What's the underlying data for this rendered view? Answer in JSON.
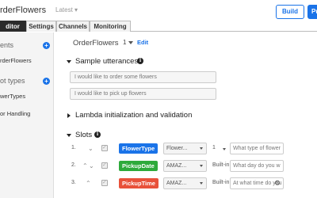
{
  "header": {
    "bot_name": "rderFlowers",
    "version": "Latest ▾",
    "build_label": "Build",
    "publish_label": "Pu"
  },
  "tabs": [
    {
      "label": "ditor",
      "active": true
    },
    {
      "label": "Settings",
      "active": false
    },
    {
      "label": "Channels",
      "active": false
    },
    {
      "label": "Monitoring",
      "active": false
    }
  ],
  "sidebar": {
    "intents_heading": "ents",
    "intent_item": "rderFlowers",
    "slot_types_heading": "ot types",
    "slot_type_item": "werTypes",
    "error_handling": "or Handling"
  },
  "main": {
    "intent_name": "OrderFlowers",
    "intent_version": "1",
    "edit_label": "Edit",
    "sample_utterances": {
      "title": "Sample utterances",
      "items": [
        "I would like to order some flowers",
        "I would like to pick up flowers"
      ]
    },
    "lambda_title": "Lambda initialization and validation",
    "slots": {
      "title": "Slots",
      "rows": [
        {
          "num": "1.",
          "name": "FlowerType",
          "color": "#1a73e8",
          "type": "Flower...",
          "version": "1",
          "prompt": "What type of flower"
        },
        {
          "num": "2.",
          "name": "PickupDate",
          "color": "#2eaa3b",
          "type": "AMAZ...",
          "version": "Built-in",
          "prompt": "What day do you w"
        },
        {
          "num": "3.",
          "name": "PickupTime",
          "color": "#e8513a",
          "type": "AMAZ...",
          "version": "Built-in",
          "prompt": "At what time do you"
        }
      ]
    }
  },
  "icons": {
    "plus": "plus-icon",
    "info": "info-icon",
    "gear": "gear-icon",
    "collapse": "caret-down-icon",
    "expand": "caret-right-icon"
  },
  "colors": {
    "accent": "#1a73e8",
    "active_tab": "#2b2b2b"
  }
}
